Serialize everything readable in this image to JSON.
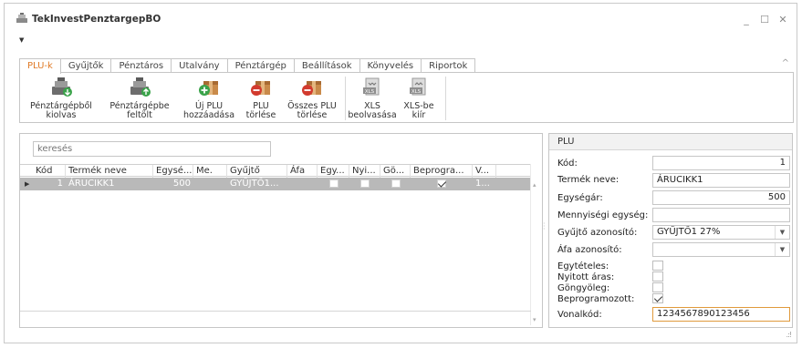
{
  "window": {
    "title": "TekInvestPenztargepBO",
    "controls": [
      "_",
      "☐",
      "✕"
    ]
  },
  "ribbon_tabs": [
    "PLU-k",
    "Gyűjtők",
    "Pénztáros",
    "Utalvány",
    "Pénztárgép",
    "Beállítások",
    "Könyvelés",
    "Riportok"
  ],
  "ribbon_buttons": [
    {
      "line1": "Pénztárgépből",
      "line2": "kiolvas"
    },
    {
      "line1": "Pénztárgépbe",
      "line2": "feltölt"
    },
    {
      "line1": "Új PLU",
      "line2": "hozzáadása"
    },
    {
      "line1": "PLU",
      "line2": "törlése"
    },
    {
      "line1": "Összes PLU",
      "line2": "törlése"
    },
    {
      "line1": "XLS",
      "line2": "beolvasása"
    },
    {
      "line1": "XLS-be",
      "line2": "kiír"
    }
  ],
  "search": {
    "placeholder": "keresés"
  },
  "grid": {
    "columns": [
      "Kód",
      "Termék neve",
      "Egysé...",
      "Me.",
      "Gyűjtő",
      "Áfa",
      "Egy...",
      "Nyi...",
      "Gö...",
      "Beprogra...",
      "V..."
    ],
    "rows": [
      {
        "kod": "1",
        "nev": "ÁRUCIKK1",
        "egyseg": "500",
        "me": "",
        "gyujto": "GYŰJTŐ1...",
        "afa": "",
        "egyteteles": false,
        "nyitott": false,
        "gongyoleg": false,
        "beprogramozott": true,
        "v": "1..."
      }
    ]
  },
  "plu_panel": {
    "title": "PLU",
    "fields": {
      "kod": {
        "label": "Kód:",
        "value": "1"
      },
      "termek_neve": {
        "label": "Termék neve:",
        "value": "ÁRUCIKK1"
      },
      "egysegar": {
        "label": "Egységár:",
        "value": "500"
      },
      "mennyisegi_egyseg": {
        "label": "Mennyiségi egység:",
        "value": ""
      },
      "gyujto_azonosito": {
        "label": "Gyűjtő azonosító:",
        "value": "GYŰJTŐ1 27%"
      },
      "afa_azonosito": {
        "label": "Áfa azonosító:",
        "value": ""
      },
      "egyteteles": {
        "label": "Egytételes:",
        "checked": false
      },
      "nyitott_aras": {
        "label": "Nyitott áras:",
        "checked": false
      },
      "gongyoleg": {
        "label": "Göngyöleg:",
        "checked": false
      },
      "beprogramozott": {
        "label": "Beprogramozott:",
        "checked": true
      },
      "vonalkod": {
        "label": "Vonalkód:",
        "value": "1234567890123456"
      }
    }
  },
  "colors": {
    "accent": "#e07b28",
    "selected_row": "#b9b9b9",
    "border": "#c6c6c6"
  },
  "icons": [
    "cash-register-icon",
    "box-add-icon",
    "box-delete-icon",
    "xls-icon",
    "qat-dropdown-icon",
    "combo-dropdown-icon",
    "resize-grip-icon"
  ]
}
